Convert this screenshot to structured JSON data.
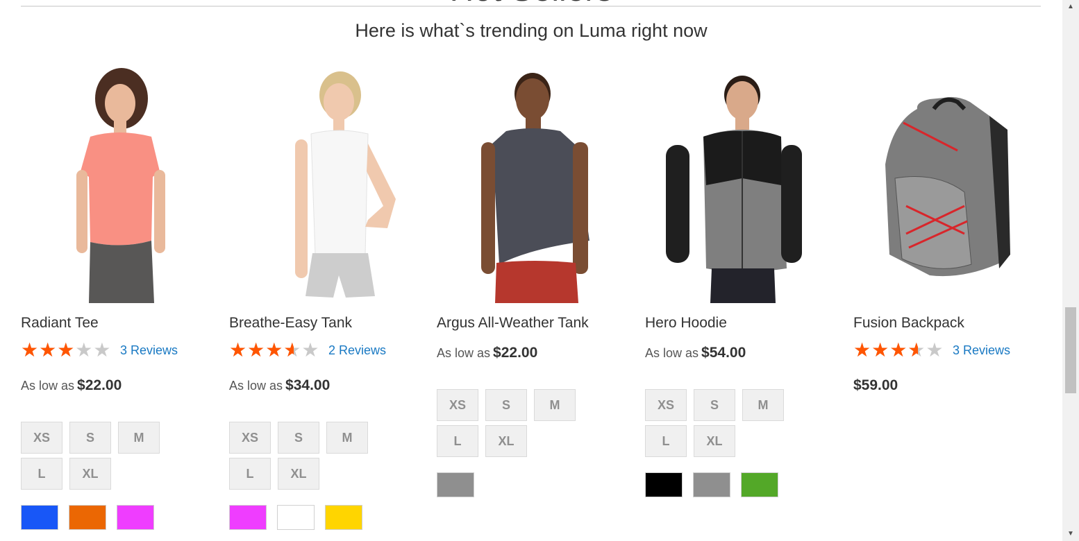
{
  "section": {
    "title": "Hot Sellers",
    "subtitle": "Here is what`s trending on Luma right now"
  },
  "products": [
    {
      "name": "Radiant Tee",
      "rating_fraction": 0.6,
      "stars": "★★★★★",
      "reviews": "3 Reviews",
      "price_prefix": "As low as",
      "price": "$22.00",
      "sizes": [
        "XS",
        "S",
        "M",
        "L",
        "XL"
      ],
      "colors": [
        "#1857f7",
        "#eb6703",
        "#ef3dff"
      ]
    },
    {
      "name": "Breathe-Easy Tank",
      "rating_fraction": 0.7,
      "stars": "★★★★★",
      "reviews": "2 Reviews",
      "price_prefix": "As low as",
      "price": "$34.00",
      "sizes": [
        "XS",
        "S",
        "M",
        "L",
        "XL"
      ],
      "colors": [
        "#ef3dff",
        "#ffffff",
        "#ffd500"
      ]
    },
    {
      "name": "Argus All-Weather Tank",
      "price_prefix": "As low as",
      "price": "$22.00",
      "sizes": [
        "XS",
        "S",
        "M",
        "L",
        "XL"
      ],
      "colors": [
        "#8f8f8f"
      ]
    },
    {
      "name": "Hero Hoodie",
      "price_prefix": "As low as",
      "price": "$54.00",
      "sizes": [
        "XS",
        "S",
        "M",
        "L",
        "XL"
      ],
      "colors": [
        "#000000",
        "#8f8f8f",
        "#53a828"
      ]
    },
    {
      "name": "Fusion Backpack",
      "rating_fraction": 0.7,
      "stars": "★★★★★",
      "reviews": "3 Reviews",
      "price": "$59.00"
    }
  ],
  "scrollbar": {
    "up_icon": "▲",
    "down_icon": "▼"
  }
}
